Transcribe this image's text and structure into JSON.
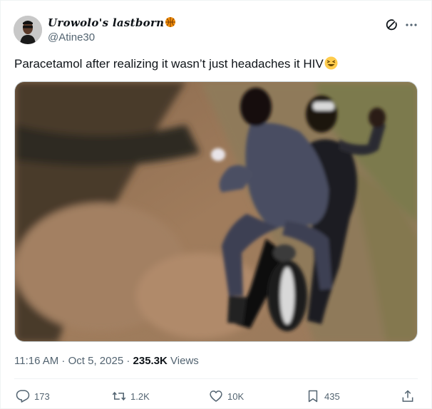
{
  "author": {
    "display_name": "Urowolo's lastborn",
    "name_emoji": "🏀",
    "handle": "@Atine30"
  },
  "header_icons": {
    "grok": "grok-icon",
    "more": "more-icon"
  },
  "tweet": {
    "text": "Paracetamol after realizing it wasn’t just headaches it HIV",
    "text_emoji": "😆"
  },
  "media": {
    "kind": "video-still"
  },
  "meta": {
    "time": "11:16 AM",
    "sep1": " · ",
    "date": "Oct 5, 2025",
    "sep2": " · ",
    "views_count": "235.3K",
    "views_label": " Views"
  },
  "actions": {
    "reply": {
      "icon": "reply-icon",
      "count": "173"
    },
    "retweet": {
      "icon": "retweet-icon",
      "count": "1.2K"
    },
    "like": {
      "icon": "heart-icon",
      "count": "10K"
    },
    "bookmark": {
      "icon": "bookmark-icon",
      "count": "435"
    },
    "share": {
      "icon": "share-icon"
    }
  },
  "colors": {
    "text": "#0f1419",
    "secondary": "#536471",
    "border": "#eff3f4"
  }
}
